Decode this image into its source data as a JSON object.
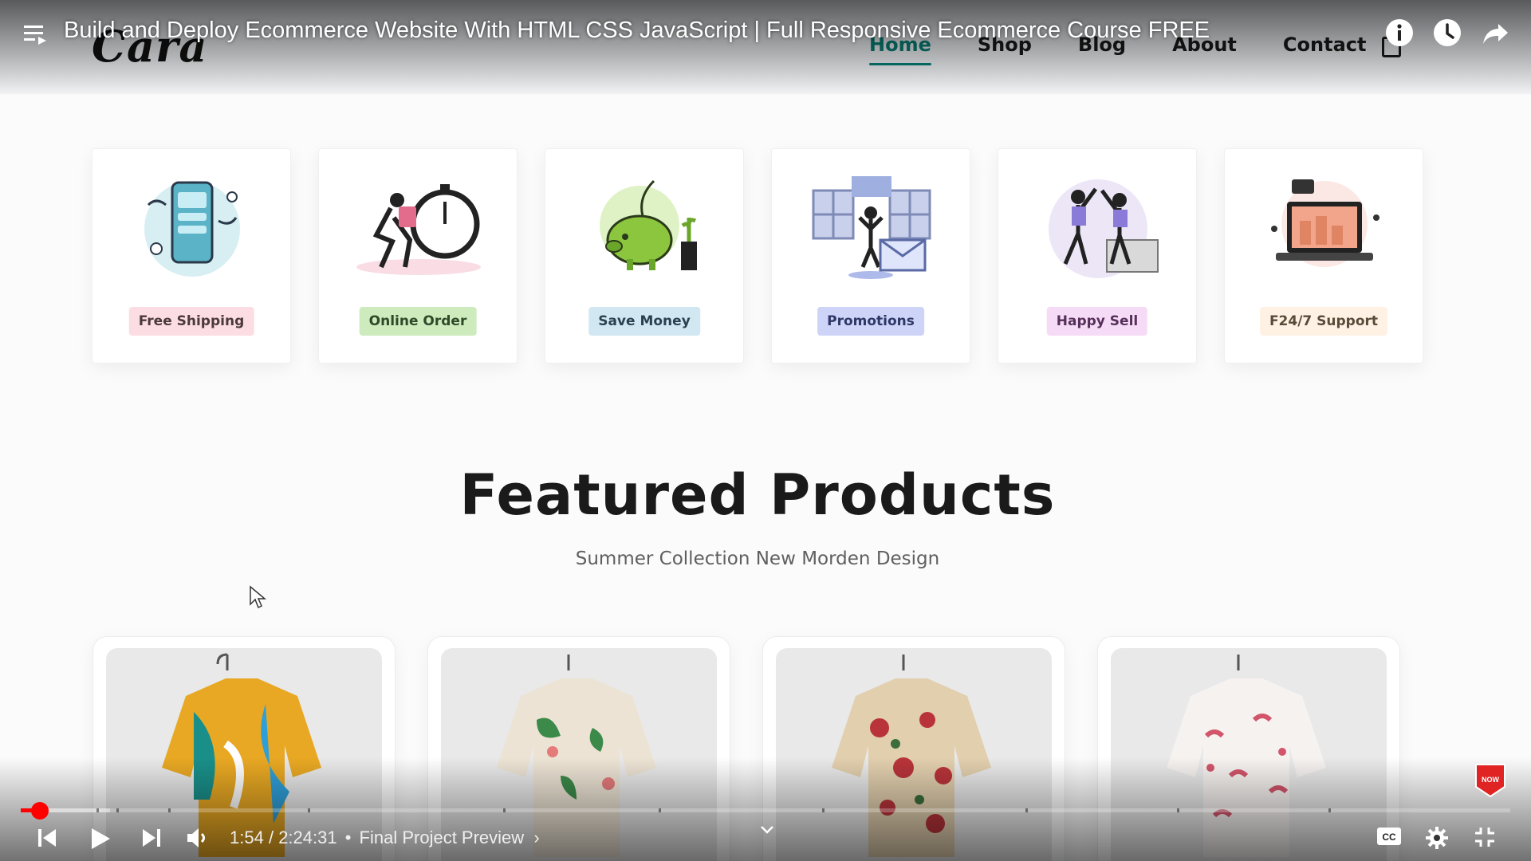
{
  "player": {
    "video_title": "Build and Deploy Ecommerce Website With HTML CSS JavaScript | Full Responsive Ecommerce Course FREE",
    "current_time": "1:54",
    "duration": "2:24:31",
    "chapter_separator": "•",
    "chapter_title": "Final Project Preview",
    "progress_fraction": 0.0131,
    "buffered_fraction": 0.06,
    "icons": {
      "playlist": "playlist-icon",
      "info": "info-icon",
      "watch_later": "clock-icon",
      "share": "share-icon",
      "previous": "skip-previous-icon",
      "play": "play-icon",
      "next": "skip-next-icon",
      "volume": "volume-icon",
      "captions": "captions-icon",
      "settings": "gear-icon",
      "exit_fullscreen": "exit-fullscreen-icon",
      "expand": "chevron-down-icon"
    },
    "accent_color": "#ff0000"
  },
  "site": {
    "logo": "Cara",
    "nav": [
      "Home",
      "Shop",
      "Blog",
      "About",
      "Contact"
    ],
    "active_nav": "Home",
    "accent_color": "#088178",
    "features": [
      {
        "label": "Free Shipping",
        "bg": "#fddde4",
        "fg": "#4a3a3d"
      },
      {
        "label": "Online Order",
        "bg": "#cdebbc",
        "fg": "#2f4a2a"
      },
      {
        "label": "Save Money",
        "bg": "#d1e8f2",
        "fg": "#2a4250"
      },
      {
        "label": "Promotions",
        "bg": "#cdd4f8",
        "fg": "#2f3766"
      },
      {
        "label": "Happy Sell",
        "bg": "#f6dbf6",
        "fg": "#55305a"
      },
      {
        "label": "F24/7 Support",
        "bg": "#fff2e5",
        "fg": "#5a4a3a"
      }
    ],
    "featured_title": "Featured Products",
    "featured_subtitle": "Summer Collection New Morden Design"
  }
}
